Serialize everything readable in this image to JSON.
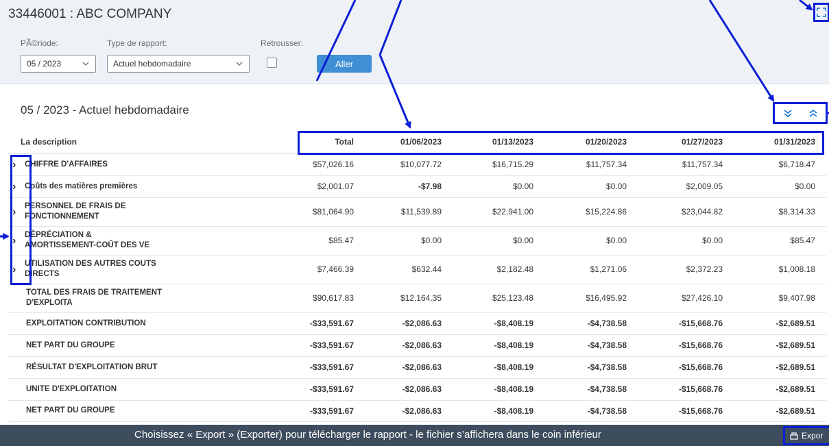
{
  "header": {
    "title": "33446001 : ABC COMPANY"
  },
  "filters": {
    "period_label": "PÃ©riode:",
    "period_value": "05 / 2023",
    "report_type_label": "Type de rapport:",
    "report_type_value": "Actuel hebdomadaire",
    "rollup_label": "Retrousser:",
    "go_label": "Aller"
  },
  "report": {
    "title": "05 / 2023 - Actuel hebdomadaire",
    "columns": [
      "La description",
      "Total",
      "01/06/2023",
      "01/13/2023",
      "01/20/2023",
      "01/27/2023",
      "01/31/2023"
    ],
    "rows": [
      {
        "label_line1": "CHIFFRE D'AFFAIRES",
        "label_line2": "",
        "values": [
          "$57,026.16",
          "$10,077.72",
          "$16,715.29",
          "$11,757.34",
          "$11,757.34",
          "$6,718.47"
        ]
      },
      {
        "label_line1": "Coûts des matières premières",
        "label_line2": "",
        "values": [
          "$2,001.07",
          "-$7.98",
          "$0.00",
          "$0.00",
          "$2,009.05",
          "$0.00"
        ]
      },
      {
        "label_line1": "PERSONNEL DE FRAIS DE",
        "label_line2": "FONCTIONNEMENT",
        "values": [
          "$81,064.90",
          "$11,539.89",
          "$22,941.00",
          "$15,224.86",
          "$23,044.82",
          "$8,314.33"
        ]
      },
      {
        "label_line1": "DÉPRÉCIATION &",
        "label_line2": "AMORTISSEMENT-COÛT DES VE",
        "values": [
          "$85.47",
          "$0.00",
          "$0.00",
          "$0.00",
          "$0.00",
          "$85.47"
        ]
      },
      {
        "label_line1": "UTILISATION DES AUTRES COUTS",
        "label_line2": "DIRECTS",
        "values": [
          "$7,466.39",
          "$632.44",
          "$2,182.48",
          "$1,271.06",
          "$2,372.23",
          "$1,008.18"
        ]
      },
      {
        "label_line1": "TOTAL DES FRAIS DE TRAITEMENT",
        "label_line2": "D'EXPLOITA",
        "values": [
          "$90,617.83",
          "$12,164.35",
          "$25,123.48",
          "$16,495.92",
          "$27,426.10",
          "$9,407.98"
        ]
      },
      {
        "label_line1": "EXPLOITATION CONTRIBUTION",
        "label_line2": "",
        "values": [
          "-$33,591.67",
          "-$2,086.63",
          "-$8,408.19",
          "-$4,738.58",
          "-$15,668.76",
          "-$2,689.51"
        ]
      },
      {
        "label_line1": "NET PART DU GROUPE",
        "label_line2": "",
        "values": [
          "-$33,591.67",
          "-$2,086.63",
          "-$8,408.19",
          "-$4,738.58",
          "-$15,668.76",
          "-$2,689.51"
        ]
      },
      {
        "label_line1": "RÉSULTAT D'EXPLOITATION BRUT",
        "label_line2": "",
        "values": [
          "-$33,591.67",
          "-$2,086.63",
          "-$8,408.19",
          "-$4,738.58",
          "-$15,668.76",
          "-$2,689.51"
        ]
      },
      {
        "label_line1": "UNITE D'EXPLOITATION",
        "label_line2": "",
        "values": [
          "-$33,591.67",
          "-$2,086.63",
          "-$8,408.19",
          "-$4,738.58",
          "-$15,668.76",
          "-$2,689.51"
        ]
      },
      {
        "label_line1": "NET PART DU GROUPE",
        "label_line2": "",
        "values": [
          "-$33,591.67",
          "-$2,086.63",
          "-$8,408.19",
          "-$4,738.58",
          "-$15,668.76",
          "-$2,689.51"
        ]
      }
    ]
  },
  "footer": {
    "instruction": "Choisissez « Export » (Exporter) pour télécharger le rapport - le fichier s’affichera dans le coin inférieur",
    "export_label": "Expor"
  },
  "colors": {
    "annotation": "#0a1fd6",
    "negative": "#d0021b",
    "link": "#0a6ed1",
    "go_button": "#3f8fd4",
    "footer_bg": "#3e4d5e"
  },
  "icons": [
    "fullscreen-icon",
    "chevron-down-icon",
    "expand-all-icon",
    "collapse-all-icon",
    "chevron-right-icon",
    "export-icon"
  ]
}
